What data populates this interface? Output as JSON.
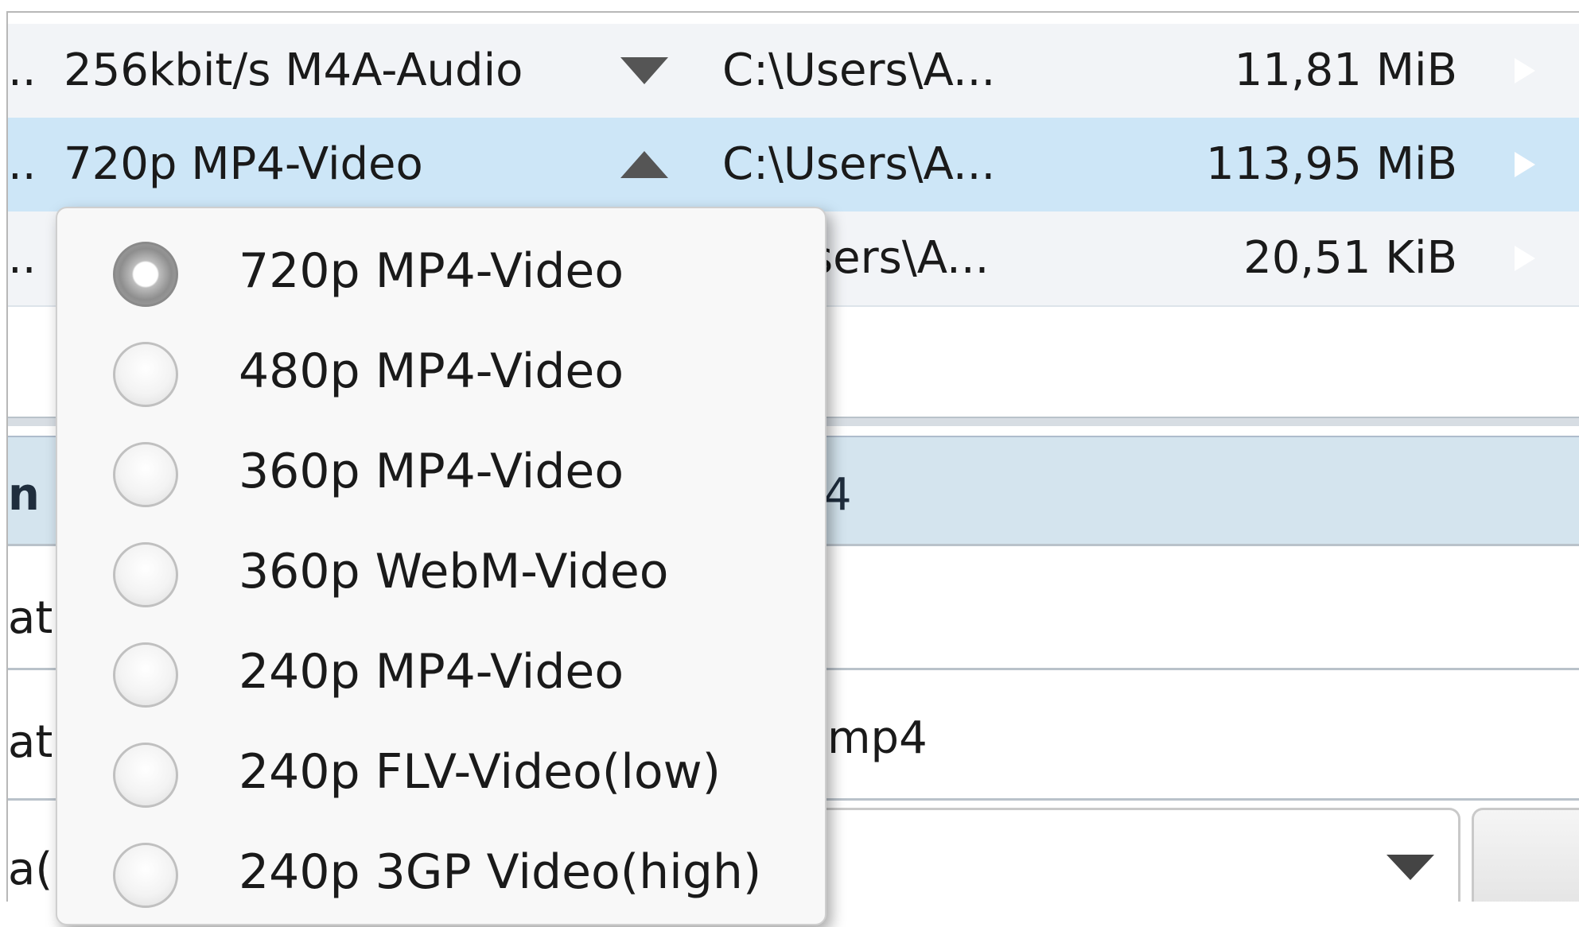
{
  "rows": [
    {
      "ellipsis": "..",
      "format": "256kbit/s M4A-Audio",
      "arrow": "down",
      "path": "C:\\Users\\A...",
      "size": "11,81 MiB"
    },
    {
      "ellipsis": "..",
      "format": "720p MP4-Video",
      "arrow": "up",
      "path": "C:\\Users\\A...",
      "size": "113,95 MiB"
    },
    {
      "ellipsis": "..",
      "format": "",
      "arrow": "",
      "path": "sers\\A...",
      "size": "20,51 KiB"
    }
  ],
  "details": {
    "header_label": "n",
    "header_tail": "4",
    "field1_label": "atl",
    "field2_label": "atl",
    "field2_tail": "mp4",
    "bottom_label": "a("
  },
  "dropdown": {
    "options": [
      {
        "label": "720p MP4-Video",
        "selected": true
      },
      {
        "label": "480p MP4-Video",
        "selected": false
      },
      {
        "label": "360p MP4-Video",
        "selected": false
      },
      {
        "label": "360p WebM-Video",
        "selected": false
      },
      {
        "label": "240p MP4-Video",
        "selected": false
      },
      {
        "label": "240p FLV-Video(low)",
        "selected": false
      },
      {
        "label": "240p 3GP Video(high)",
        "selected": false
      }
    ]
  },
  "icons": {
    "play": "play-icon",
    "arrow_down": "chevron-down-icon",
    "arrow_up": "chevron-up-icon"
  },
  "colors": {
    "selected_row": "#cde6f7",
    "play_button": "#c41a1a",
    "header_band": "#d4e4ee"
  }
}
